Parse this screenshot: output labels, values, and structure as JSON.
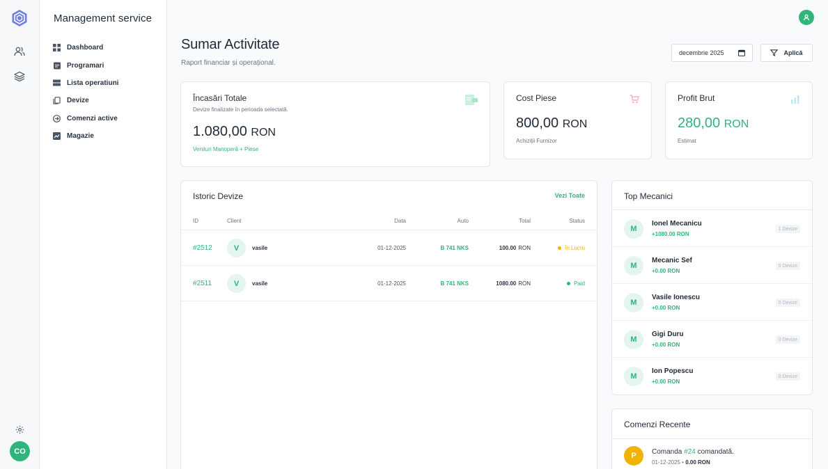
{
  "sidebar": {
    "title": "Management service",
    "items": [
      {
        "label": "Dashboard"
      },
      {
        "label": "Programari"
      },
      {
        "label": "Lista operatiuni"
      },
      {
        "label": "Devize"
      },
      {
        "label": "Comenzi active"
      },
      {
        "label": "Magazie"
      }
    ]
  },
  "rail": {
    "avatar": "CO"
  },
  "header": {
    "title": "Sumar Activitate",
    "subtitle": "Raport financiar și operațional.",
    "date_value": "decembrie 2025",
    "apply_label": "Aplică"
  },
  "stats": {
    "income": {
      "title": "Încasări Totale",
      "desc": "Devize finalizate în perioada selectată.",
      "value": "1.080,00",
      "unit": "RON",
      "foot": "Venituri Manoperă + Piese"
    },
    "cost": {
      "title": "Cost Piese",
      "value": "800,00",
      "unit": "RON",
      "foot": "Achiziții Furnizor"
    },
    "profit": {
      "title": "Profit Brut",
      "value": "280,00",
      "unit": "RON",
      "foot": "Estimat"
    }
  },
  "history": {
    "title": "Istoric Devize",
    "see_all": "Vezi Toate",
    "columns": [
      "ID",
      "Client",
      "Data",
      "Auto",
      "Total",
      "Status"
    ],
    "rows": [
      {
        "id": "#2512",
        "initial": "V",
        "client": "vasile",
        "date": "01-12-2025",
        "auto": "B 741 NKS",
        "total": "100.00",
        "currency": "RON",
        "status": "În Lucru"
      },
      {
        "id": "#2511",
        "initial": "V",
        "client": "vasile",
        "date": "01-12-2025",
        "auto": "B 741 NKS",
        "total": "1080.00",
        "currency": "RON",
        "status": "Paid"
      }
    ]
  },
  "mechanics": {
    "title": "Top Mecanici",
    "items": [
      {
        "initial": "M",
        "name": "Ionel Mecanicu",
        "earn": "+1080.00 RON",
        "badge": "1 Devize"
      },
      {
        "initial": "M",
        "name": "Mecanic Sef",
        "earn": "+0.00 RON",
        "badge": "0 Devize"
      },
      {
        "initial": "M",
        "name": "Vasile Ionescu",
        "earn": "+0.00 RON",
        "badge": "0 Devize"
      },
      {
        "initial": "M",
        "name": "Gigi Duru",
        "earn": "+0.00 RON",
        "badge": "0 Devize"
      },
      {
        "initial": "M",
        "name": "Ion Popescu",
        "earn": "+0.00 RON",
        "badge": "0 Devize"
      }
    ]
  },
  "orders": {
    "title": "Comenzi Recente",
    "items": [
      {
        "initial": "P",
        "text_prefix": "Comanda",
        "number": "#24",
        "text_suffix": "comandată.",
        "date": "01-12-2025",
        "separator": "•",
        "amount": "0.00 RON"
      }
    ]
  },
  "colors": {
    "accent": "#2fb47b",
    "warning": "#f0b400",
    "logo": "#6f7fe0"
  }
}
